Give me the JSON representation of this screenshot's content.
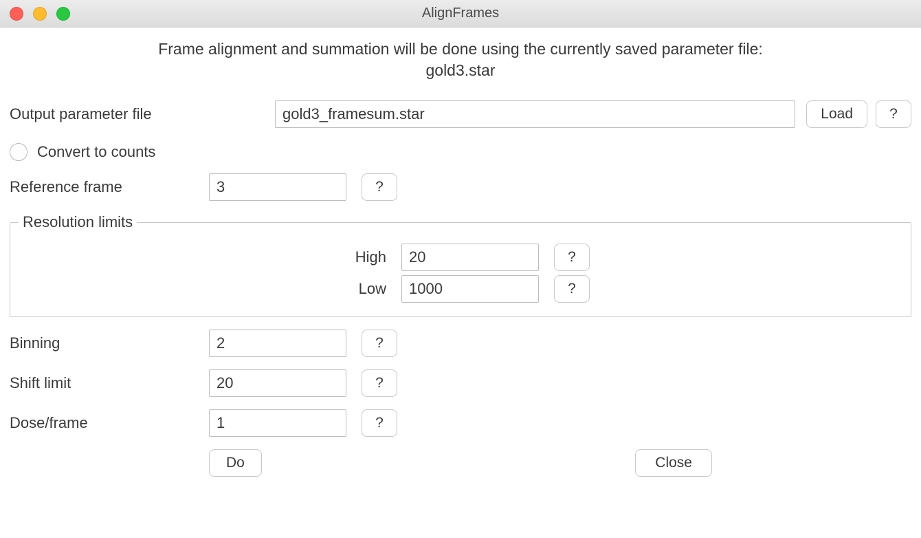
{
  "window": {
    "title": "AlignFrames"
  },
  "header": {
    "line1": "Frame alignment and summation will be done using the currently saved parameter file:",
    "line2": "gold3.star"
  },
  "output": {
    "label": "Output parameter file",
    "value": "gold3_framesum.star",
    "load_label": "Load",
    "help_label": "?"
  },
  "convert": {
    "label": "Convert to counts",
    "checked": false
  },
  "reference": {
    "label": "Reference frame",
    "value": "3",
    "help_label": "?"
  },
  "resolution": {
    "legend": "Resolution limits",
    "high_label": "High",
    "high_value": "20",
    "low_label": "Low",
    "low_value": "1000",
    "help_label": "?"
  },
  "binning": {
    "label": "Binning",
    "value": "2",
    "help_label": "?"
  },
  "shift": {
    "label": "Shift limit",
    "value": "20",
    "help_label": "?"
  },
  "dose": {
    "label": "Dose/frame",
    "value": "1",
    "help_label": "?"
  },
  "footer": {
    "do_label": "Do",
    "close_label": "Close"
  }
}
